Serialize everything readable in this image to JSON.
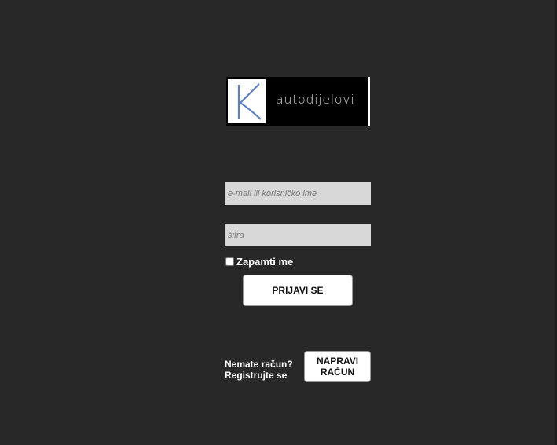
{
  "logo": {
    "text": "autodijelovi",
    "mark_icon": "k-letter-logo",
    "mark_color": "#5b7fc4"
  },
  "form": {
    "email_placeholder": "e-mail ili korisničko ime",
    "password_placeholder": "šifra",
    "remember_label": "Zapamti me",
    "remember_checked": false,
    "login_label": "PRIJAVI SE"
  },
  "register": {
    "line1": "Nemate račun?",
    "line2": "Registrujte se",
    "button_line1": "NAPRAVI",
    "button_line2": "RAČUN"
  },
  "colors": {
    "background": "#282828",
    "field_background": "#d8d8d8",
    "button_background": "#ffffff"
  }
}
